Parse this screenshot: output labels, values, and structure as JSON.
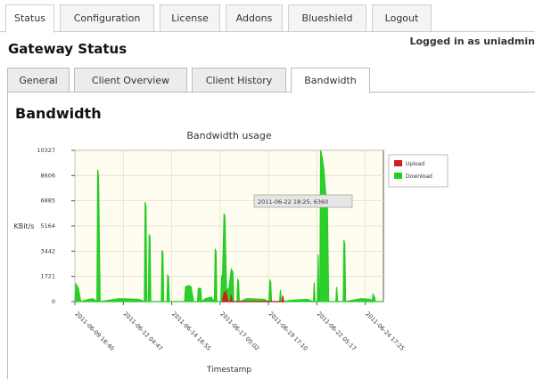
{
  "top_nav": {
    "tabs": [
      {
        "label": "Status",
        "active": true
      },
      {
        "label": "Configuration",
        "active": false
      },
      {
        "label": "License",
        "active": false
      },
      {
        "label": "Addons",
        "active": false
      },
      {
        "label": "Blueshield",
        "active": false
      },
      {
        "label": "Logout",
        "active": false
      }
    ]
  },
  "header": {
    "title": "Gateway Status",
    "logged_in": "Logged in as uniadmin"
  },
  "sub_nav": {
    "tabs": [
      {
        "label": "General",
        "active": false
      },
      {
        "label": "Client Overview",
        "active": false
      },
      {
        "label": "Client History",
        "active": false
      },
      {
        "label": "Bandwidth",
        "active": true
      }
    ]
  },
  "section": {
    "title": "Bandwidth"
  },
  "colors": {
    "upload": "#cc1f1f",
    "download": "#22cc22",
    "plot_bg": "#fffdf0"
  },
  "chart_data": {
    "type": "area",
    "title": "Bandwidth usage",
    "xlabel": "Timestamp",
    "ylabel": "KBit/s",
    "ylim": [
      0,
      10327
    ],
    "y_ticks": [
      "0",
      "1721",
      "3442",
      "5164",
      "6885",
      "8606",
      "10327"
    ],
    "x_ticks": [
      "2011-06-09 16:40",
      "2011-06-12 04:47",
      "2011-06-14 16:55",
      "2011-06-17 05:02",
      "2011-06-19 17:10",
      "2011-06-22 05:17",
      "2011-06-24 17:25"
    ],
    "x_start": "2011-06-09 16:40",
    "x_end": "2011-06-25 16:00",
    "grid": true,
    "legend_position": "top-right",
    "tooltip": "2011-06-22 18:25, 6360",
    "series": [
      {
        "name": "Upload",
        "points": [
          [
            "2011-06-17 08:00",
            0
          ],
          [
            "2011-06-17 10:00",
            600
          ],
          [
            "2011-06-17 12:00",
            700
          ],
          [
            "2011-06-17 15:00",
            0
          ],
          [
            "2011-06-17 18:00",
            0
          ],
          [
            "2011-06-17 19:00",
            450
          ],
          [
            "2011-06-17 20:00",
            0
          ],
          [
            "2011-06-20 10:00",
            0
          ],
          [
            "2011-06-20 11:00",
            400
          ],
          [
            "2011-06-20 12:00",
            0
          ]
        ]
      },
      {
        "name": "Download",
        "points": [
          [
            "2011-06-09 16:40",
            0
          ],
          [
            "2011-06-09 18:00",
            1200
          ],
          [
            "2011-06-09 21:00",
            900
          ],
          [
            "2011-06-10 00:00",
            0
          ],
          [
            "2011-06-10 10:00",
            150
          ],
          [
            "2011-06-10 15:00",
            200
          ],
          [
            "2011-06-10 20:00",
            0
          ],
          [
            "2011-06-10 21:00",
            9000
          ],
          [
            "2011-06-10 22:00",
            8500
          ],
          [
            "2011-06-11 00:00",
            0
          ],
          [
            "2011-06-12 00:00",
            200
          ],
          [
            "2011-06-13 00:00",
            150
          ],
          [
            "2011-06-13 07:00",
            0
          ],
          [
            "2011-06-13 08:00",
            6800
          ],
          [
            "2011-06-13 09:00",
            6500
          ],
          [
            "2011-06-13 10:00",
            0
          ],
          [
            "2011-06-13 12:00",
            0
          ],
          [
            "2011-06-13 13:00",
            4600
          ],
          [
            "2011-06-13 14:00",
            4400
          ],
          [
            "2011-06-13 15:00",
            0
          ],
          [
            "2011-06-14 04:00",
            0
          ],
          [
            "2011-06-14 05:00",
            3500
          ],
          [
            "2011-06-14 06:00",
            3300
          ],
          [
            "2011-06-14 07:00",
            0
          ],
          [
            "2011-06-14 11:00",
            0
          ],
          [
            "2011-06-14 12:00",
            1800
          ],
          [
            "2011-06-14 13:00",
            1700
          ],
          [
            "2011-06-14 14:00",
            0
          ],
          [
            "2011-06-15 09:00",
            0
          ],
          [
            "2011-06-15 10:00",
            1000
          ],
          [
            "2011-06-15 14:00",
            1100
          ],
          [
            "2011-06-15 17:00",
            1000
          ],
          [
            "2011-06-15 20:00",
            0
          ],
          [
            "2011-06-16 01:00",
            0
          ],
          [
            "2011-06-16 02:00",
            900
          ],
          [
            "2011-06-16 05:00",
            900
          ],
          [
            "2011-06-16 06:00",
            0
          ],
          [
            "2011-06-16 11:00",
            200
          ],
          [
            "2011-06-16 18:00",
            300
          ],
          [
            "2011-06-16 22:00",
            0
          ],
          [
            "2011-06-16 23:00",
            3600
          ],
          [
            "2011-06-17 00:00",
            3400
          ],
          [
            "2011-06-17 01:00",
            0
          ],
          [
            "2011-06-17 06:00",
            0
          ],
          [
            "2011-06-17 07:00",
            1800
          ],
          [
            "2011-06-17 08:00",
            1500
          ],
          [
            "2011-06-17 10:00",
            6000
          ],
          [
            "2011-06-17 11:00",
            5800
          ],
          [
            "2011-06-17 13:00",
            800
          ],
          [
            "2011-06-17 16:00",
            900
          ],
          [
            "2011-06-17 19:00",
            2200
          ],
          [
            "2011-06-17 21:00",
            2000
          ],
          [
            "2011-06-17 22:00",
            0
          ],
          [
            "2011-06-18 02:00",
            0
          ],
          [
            "2011-06-18 03:00",
            1500
          ],
          [
            "2011-06-18 04:00",
            1400
          ],
          [
            "2011-06-18 05:00",
            0
          ],
          [
            "2011-06-18 14:00",
            200
          ],
          [
            "2011-06-19 12:00",
            150
          ],
          [
            "2011-06-19 18:00",
            0
          ],
          [
            "2011-06-19 19:00",
            1500
          ],
          [
            "2011-06-19 20:00",
            1300
          ],
          [
            "2011-06-19 21:00",
            0
          ],
          [
            "2011-06-20 07:00",
            0
          ],
          [
            "2011-06-20 08:00",
            800
          ],
          [
            "2011-06-20 09:00",
            0
          ],
          [
            "2011-06-21 00:00",
            100
          ],
          [
            "2011-06-21 17:00",
            150
          ],
          [
            "2011-06-22 01:00",
            0
          ],
          [
            "2011-06-22 02:00",
            1300
          ],
          [
            "2011-06-22 03:00",
            0
          ],
          [
            "2011-06-22 06:00",
            0
          ],
          [
            "2011-06-22 07:00",
            3200
          ],
          [
            "2011-06-22 08:00",
            0
          ],
          [
            "2011-06-22 09:00",
            0
          ],
          [
            "2011-06-22 10:00",
            10327
          ],
          [
            "2011-06-22 12:00",
            9800
          ],
          [
            "2011-06-22 14:00",
            9000
          ],
          [
            "2011-06-22 16:00",
            7600
          ],
          [
            "2011-06-22 18:25",
            6360
          ],
          [
            "2011-06-22 20:00",
            0
          ],
          [
            "2011-06-23 05:00",
            0
          ],
          [
            "2011-06-23 06:00",
            1000
          ],
          [
            "2011-06-23 07:00",
            0
          ],
          [
            "2011-06-23 14:00",
            0
          ],
          [
            "2011-06-23 15:00",
            4200
          ],
          [
            "2011-06-23 16:00",
            3900
          ],
          [
            "2011-06-23 17:00",
            0
          ],
          [
            "2011-06-24 12:00",
            200
          ],
          [
            "2011-06-25 00:00",
            150
          ],
          [
            "2011-06-25 02:00",
            0
          ],
          [
            "2011-06-25 03:00",
            500
          ],
          [
            "2011-06-25 05:00",
            300
          ],
          [
            "2011-06-25 06:00",
            0
          ],
          [
            "2011-06-25 16:00",
            0
          ]
        ]
      }
    ]
  }
}
